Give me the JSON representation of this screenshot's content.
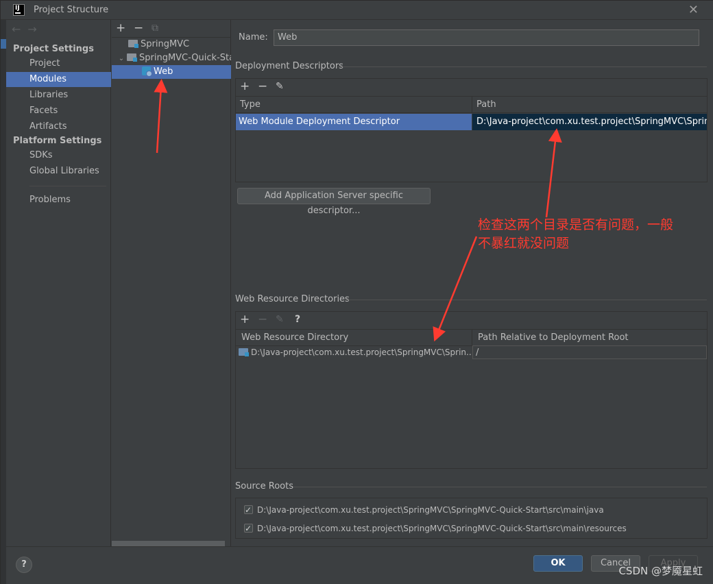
{
  "window": {
    "title": "Project Structure"
  },
  "nav": {
    "project_settings_header": "Project Settings",
    "platform_settings_header": "Platform Settings",
    "items": [
      {
        "label": "Project"
      },
      {
        "label": "Modules",
        "selected": true
      },
      {
        "label": "Libraries"
      },
      {
        "label": "Facets"
      },
      {
        "label": "Artifacts"
      },
      {
        "label": "SDKs"
      },
      {
        "label": "Global Libraries"
      },
      {
        "label": "Problems"
      }
    ]
  },
  "tree": {
    "nodes": [
      {
        "label": "SpringMVC"
      },
      {
        "label": "SpringMVC-Quick-Start"
      },
      {
        "label": "Web",
        "selected": true
      }
    ]
  },
  "main": {
    "name_label": "Name:",
    "name_value": "Web",
    "deployment_descriptors": {
      "section_title": "Deployment Descriptors",
      "columns": [
        "Type",
        "Path"
      ],
      "rows": [
        {
          "type": "Web Module Deployment Descriptor",
          "path": "D:\\Java-project\\com.xu.test.project\\SpringMVC\\SpringMVC"
        }
      ],
      "add_button": "Add Application Server specific descriptor..."
    },
    "web_resource_directories": {
      "section_title": "Web Resource Directories",
      "columns": [
        "Web Resource Directory",
        "Path Relative to Deployment Root"
      ],
      "rows": [
        {
          "directory": "D:\\Java-project\\com.xu.test.project\\SpringMVC\\Sprin...",
          "relative": "/"
        }
      ]
    },
    "source_roots": {
      "section_title": "Source Roots",
      "items": [
        {
          "path": "D:\\Java-project\\com.xu.test.project\\SpringMVC\\SpringMVC-Quick-Start\\src\\main\\java",
          "checked": true
        },
        {
          "path": "D:\\Java-project\\com.xu.test.project\\SpringMVC\\SpringMVC-Quick-Start\\src\\main\\resources",
          "checked": true
        }
      ]
    }
  },
  "footer": {
    "help": "?",
    "ok": "OK",
    "cancel": "Cancel",
    "apply": "Apply"
  },
  "annotation": {
    "line1": "检查这两个目录是否有问题，一般",
    "line2": "不暴红就没问题",
    "color": "#ff3b30"
  },
  "watermark": "CSDN @梦魇星虹",
  "colors": {
    "selection": "#4b6eaf",
    "ok_button": "#365880",
    "background": "#3c3f41"
  }
}
